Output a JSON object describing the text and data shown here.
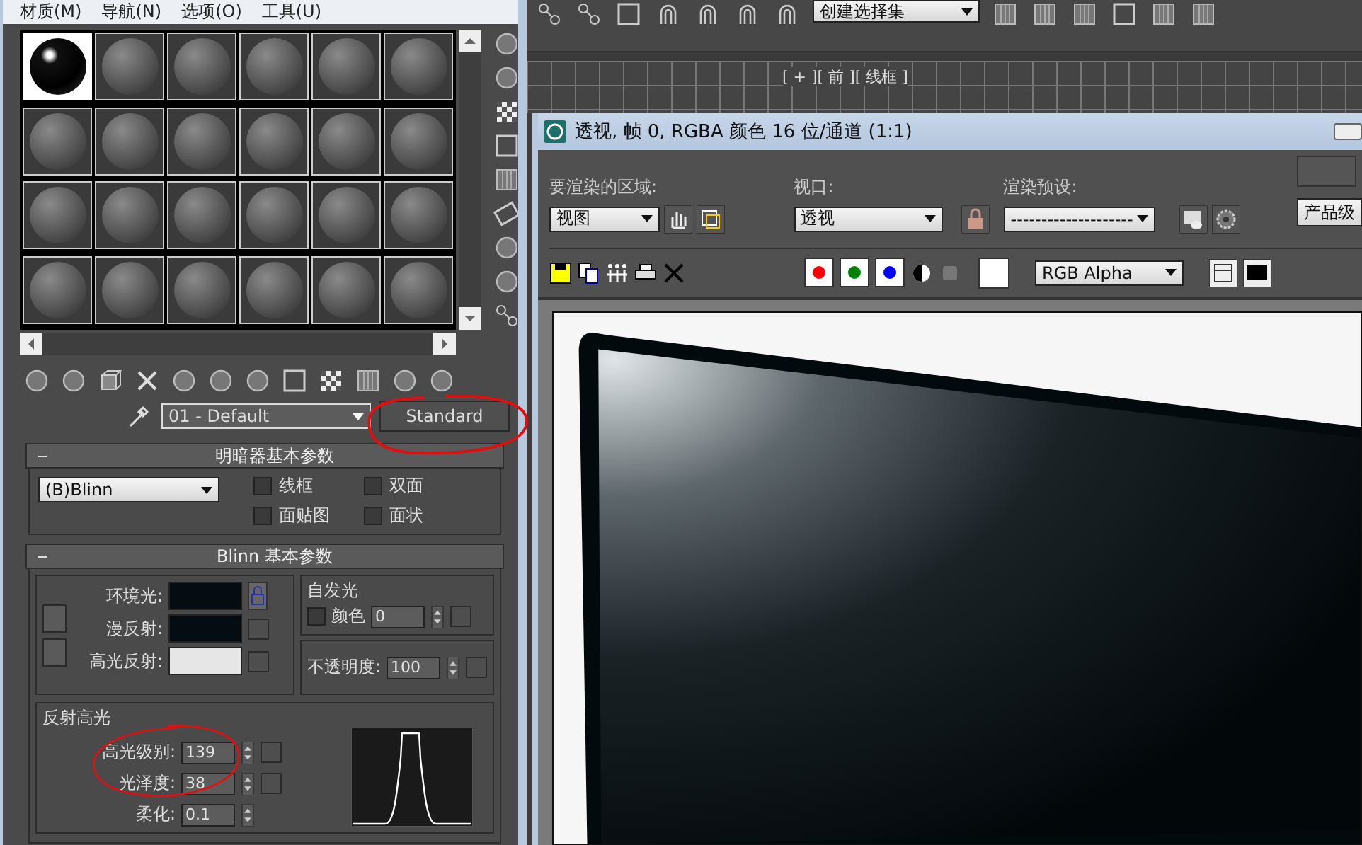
{
  "menu": [
    {
      "label": "材质(M)"
    },
    {
      "label": "导航(N)"
    },
    {
      "label": "选项(O)"
    },
    {
      "label": "工具(U)"
    }
  ],
  "sample_slots": [
    {
      "selected": true
    },
    {
      "selected": false
    },
    {
      "selected": false
    },
    {
      "selected": false
    },
    {
      "selected": false
    },
    {
      "selected": false
    },
    {
      "selected": false
    },
    {
      "selected": false
    },
    {
      "selected": false
    },
    {
      "selected": false
    },
    {
      "selected": false
    },
    {
      "selected": false
    },
    {
      "selected": false
    },
    {
      "selected": false
    },
    {
      "selected": false
    },
    {
      "selected": false
    },
    {
      "selected": false
    },
    {
      "selected": false
    },
    {
      "selected": false
    },
    {
      "selected": false
    },
    {
      "selected": false
    },
    {
      "selected": false
    },
    {
      "selected": false
    },
    {
      "selected": false
    }
  ],
  "material_name": "01 - Default",
  "material_type": "Standard",
  "shader_rollout": {
    "title": "明暗器基本参数",
    "shader": "(B)Blinn",
    "options": [
      {
        "label": "线框",
        "checked": false
      },
      {
        "label": "双面",
        "checked": false
      },
      {
        "label": "面贴图",
        "checked": false
      },
      {
        "label": "面状",
        "checked": false
      }
    ]
  },
  "blinn_rollout": {
    "title": "Blinn 基本参数",
    "colors": [
      {
        "label": "环境光:",
        "color": "#050c12"
      },
      {
        "label": "漫反射:",
        "color": "#050c12"
      },
      {
        "label": "高光反射:",
        "color": "#e6e6e6"
      }
    ],
    "self_illum": {
      "title": "自发光",
      "label": "颜色",
      "checked": false,
      "value": "0"
    },
    "opacity": {
      "label": "不透明度:",
      "value": "100"
    },
    "specular": {
      "title": "反射高光",
      "fields": [
        {
          "label": "高光级别:",
          "value": "139"
        },
        {
          "label": "光泽度:",
          "value": "38"
        },
        {
          "label": "柔化:",
          "value": "0.1"
        }
      ]
    }
  },
  "toolbar_dropdown": "创建选择集",
  "viewport_label": "[ + ][ 前 ][ 线框 ]",
  "render_window": {
    "title": "透视, 帧 0, RGBA 颜色 16 位/通道 (1:1)",
    "area": {
      "label": "要渲染的区域:",
      "value": "视图"
    },
    "viewport": {
      "label": "视口:",
      "value": "透视"
    },
    "preset": {
      "label": "渲染预设:",
      "value": "--------------------"
    },
    "quality": "产品级",
    "channels": [
      {
        "color": "#ff0000"
      },
      {
        "color": "#008000"
      },
      {
        "color": "#0000ff"
      }
    ],
    "channel_display": "RGB Alpha"
  }
}
